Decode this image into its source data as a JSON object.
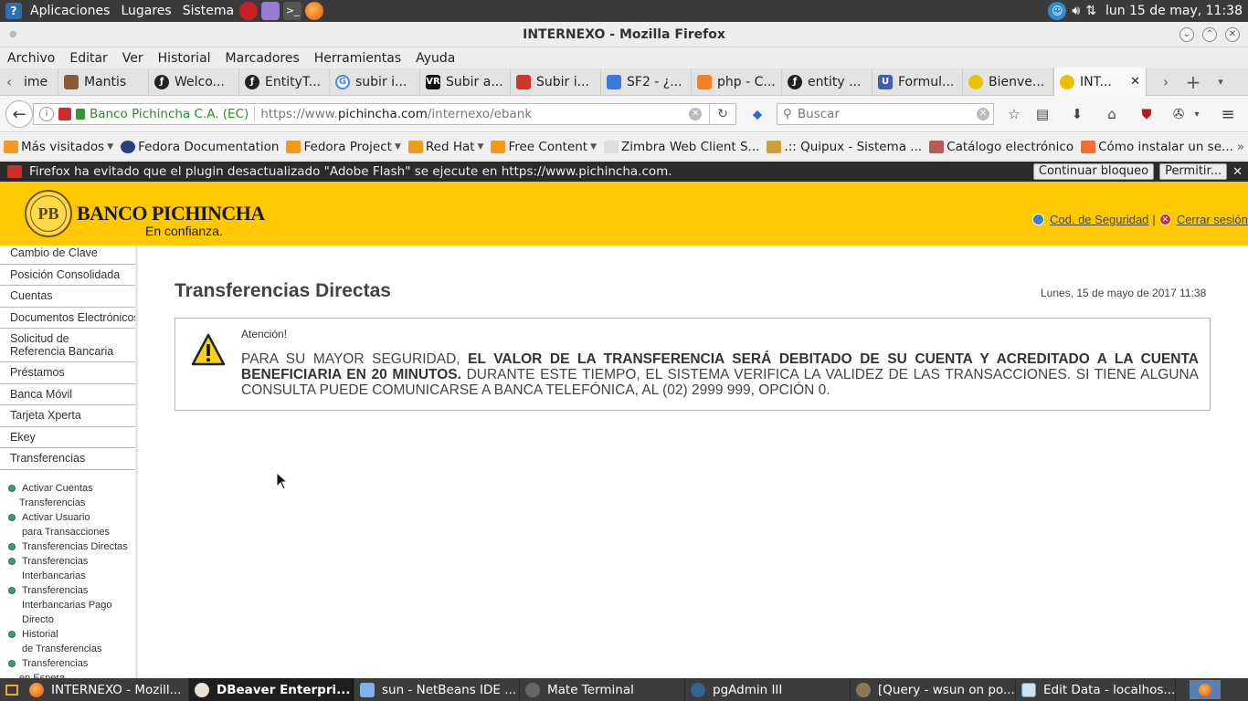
{
  "top_panel": {
    "menus": [
      "Aplicaciones",
      "Lugares",
      "Sistema"
    ],
    "clock": "lun 15 de may, 11:38"
  },
  "window": {
    "title": "INTERNEXO - Mozilla Firefox"
  },
  "menubar": [
    "Archivo",
    "Editar",
    "Ver",
    "Historial",
    "Marcadores",
    "Herramientas",
    "Ayuda"
  ],
  "tabs": [
    {
      "label": "ime",
      "icon": "partial-tab"
    },
    {
      "label": "Mantis",
      "icon": "mantis-icon"
    },
    {
      "label": "Welco...",
      "icon": "symfony-icon"
    },
    {
      "label": "EntityT...",
      "icon": "symfony-icon"
    },
    {
      "label": "subir i...",
      "icon": "google-icon"
    },
    {
      "label": "Subir a...",
      "icon": "vr-icon"
    },
    {
      "label": "Subir i...",
      "icon": "book-icon"
    },
    {
      "label": "SF2 - ¿...",
      "icon": "sf2-icon"
    },
    {
      "label": "php - C...",
      "icon": "stackoverflow-icon"
    },
    {
      "label": "entity ...",
      "icon": "symfony-icon"
    },
    {
      "label": "Formul...",
      "icon": "uo-icon"
    },
    {
      "label": "Bienve...",
      "icon": "pichincha-icon"
    },
    {
      "label": "INT...",
      "icon": "pichincha-icon",
      "active": true
    }
  ],
  "navbar": {
    "site_identity": "Banco Pichincha C.A. (EC)",
    "url_prefix": "https://www.",
    "url_domain": "pichincha.com",
    "url_path": "/internexo/ebank",
    "search_placeholder": "Buscar"
  },
  "bookmarks": [
    {
      "label": "Más visitados",
      "dropdown": true,
      "icon": "folder-orange"
    },
    {
      "label": "Fedora Documentation",
      "dropdown": false,
      "icon": "fedora"
    },
    {
      "label": "Fedora Project",
      "dropdown": true,
      "icon": "folder-orange"
    },
    {
      "label": "Red Hat",
      "dropdown": true,
      "icon": "folder-orange"
    },
    {
      "label": "Free Content",
      "dropdown": true,
      "icon": "folder-orange"
    },
    {
      "label": "Zimbra Web Client S...",
      "dropdown": false,
      "icon": "zimbra"
    },
    {
      "label": ".:: Quipux - Sistema ...",
      "dropdown": false,
      "icon": "quipux"
    },
    {
      "label": "Catálogo electrónico",
      "dropdown": false,
      "icon": "catalogo"
    },
    {
      "label": "Cómo instalar un se...",
      "dropdown": false,
      "icon": "joomla"
    }
  ],
  "plugin_bar": {
    "message": "Firefox ha evitado que el plugin desactualizado \"Adobe Flash\" se ejecute en https://www.pichincha.com.",
    "continue_label": "Continuar bloqueo",
    "allow_label": "Permitir..."
  },
  "bank": {
    "logo_name": "BANCO PICHINCHA",
    "logo_tagline": "En confianza.",
    "security_code_link": "Cod. de Seguridad",
    "separator": "|",
    "logout_link": "Cerrar sesión",
    "brand_color": "#ffc900"
  },
  "sidebar": {
    "items": [
      "Cambio de Clave",
      "Posición Consolidada",
      "Cuentas",
      "Documentos Electrónicos",
      "Solicitud de Referencia Bancaria",
      "Préstamos",
      "Banca Móvil",
      "Tarjeta Xperta",
      "Ekey",
      "Transferencias"
    ],
    "subitems": [
      {
        "line1": "Activar Cuentas",
        "line2": "Transferencias"
      },
      {
        "line1": "Activar Usuario",
        "line2": "para Transacciones"
      },
      {
        "line1": "Transferencias Directas",
        "line2": ""
      },
      {
        "line1": "Transferencias",
        "line2": "Interbancarias"
      },
      {
        "line1": "Transferencias",
        "line2": "Interbancarias Pago",
        "line3": "Directo"
      },
      {
        "line1": "Historial",
        "line2": "de Transferencias"
      },
      {
        "line1": "Transferencias",
        "line2": "en Espera"
      }
    ]
  },
  "main": {
    "page_title": "Transferencias Directas",
    "date": "Lunes, 15 de mayo de 2017 11:38",
    "notice": {
      "heading": "Atención!",
      "text_normal_1": "PARA SU MAYOR SEGURIDAD, ",
      "text_bold": "EL VALOR DE LA TRANSFERENCIA SERÁ DEBITADO DE SU CUENTA Y ACREDITADO A LA CUENTA BENEFICIARIA EN 20 MINUTOS.",
      "text_normal_2": " DURANTE ESTE TIEMPO, EL SISTEMA VERIFICA LA VALIDEZ DE LAS TRANSACCIONES. SI TIENE ALGUNA CONSULTA PUEDE COMUNICARSE A BANCA TELEFÓNICA, AL (02) 2999 999, OPCIÓN 0."
    }
  },
  "taskbar": [
    {
      "label": "INTERNEXO - Mozill...",
      "icon": "firefox-icon",
      "active": false
    },
    {
      "label": "DBeaver Enterpri...",
      "icon": "dbeaver-icon",
      "active": true
    },
    {
      "label": "sun - NetBeans IDE ...",
      "icon": "netbeans-icon",
      "active": false
    },
    {
      "label": "Mate Terminal",
      "icon": "terminal-icon",
      "active": false
    },
    {
      "label": "pgAdmin III",
      "icon": "pgadmin-icon",
      "active": false
    },
    {
      "label": "[Query - wsun on po...",
      "icon": "query-icon",
      "active": false
    },
    {
      "label": "Edit Data - localhos...",
      "icon": "editdata-icon",
      "active": false
    }
  ]
}
